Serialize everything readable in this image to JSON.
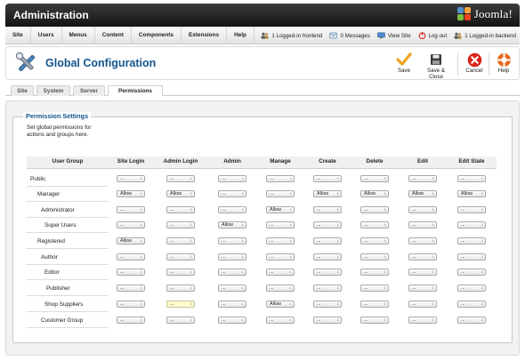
{
  "header": {
    "title": "Administration",
    "logo_text": "Joomla!"
  },
  "menu": [
    "Site",
    "Users",
    "Menus",
    "Content",
    "Components",
    "Extensions",
    "Help"
  ],
  "status": {
    "frontend": "1 Logged-in frontend",
    "messages": "0 Messages",
    "view_site": "View Site",
    "logout": "Log out",
    "backend": "1 Logged-in backend"
  },
  "toolbar": {
    "page_title": "Global Configuration",
    "buttons": [
      "Save",
      "Save & Close",
      "Cancel",
      "Help"
    ]
  },
  "tabs": [
    "Site",
    "System",
    "Server",
    "Permissions"
  ],
  "active_tab": "Permissions",
  "permissions": {
    "legend": "Permission Settings",
    "description": "Set global permissions for actions and groups here.",
    "group_header": "User Group",
    "actions": [
      "Site Login",
      "Admin Login",
      "Admin",
      "Manage",
      "Create",
      "Delete",
      "Edit",
      "Edit State"
    ],
    "rows": [
      {
        "group": "Public",
        "values": [
          "...",
          "...",
          "...",
          "...",
          "...",
          "...",
          "...",
          "..."
        ]
      },
      {
        "group": "Manager",
        "values": [
          "Allow",
          "Allow",
          "...",
          "...",
          "Allow",
          "Allow",
          "Allow",
          "Allow"
        ]
      },
      {
        "group": "Administrator",
        "values": [
          "...",
          "...",
          "...",
          "Allow",
          "...",
          "...",
          "...",
          "..."
        ]
      },
      {
        "group": "Super Users",
        "values": [
          "...",
          "...",
          "Allow",
          "...",
          "...",
          "...",
          "...",
          "..."
        ]
      },
      {
        "group": "Registered",
        "values": [
          "Allow",
          "...",
          "...",
          "...",
          "...",
          "...",
          "...",
          "..."
        ]
      },
      {
        "group": "Author",
        "values": [
          "...",
          "...",
          "...",
          "...",
          "...",
          "...",
          "...",
          "..."
        ]
      },
      {
        "group": "Editor",
        "values": [
          "...",
          "...",
          "...",
          "...",
          "...",
          "...",
          "...",
          "..."
        ]
      },
      {
        "group": "Publisher",
        "values": [
          "...",
          "...",
          "...",
          "...",
          "...",
          "...",
          "...",
          "..."
        ]
      },
      {
        "group": "Shop Suppliers",
        "values": [
          "...",
          "...",
          "...",
          "Allow",
          "...",
          "...",
          "...",
          "..."
        ]
      },
      {
        "group": "Customer Group",
        "values": [
          "...",
          "...",
          "...",
          "...",
          "...",
          "...",
          "...",
          "..."
        ]
      }
    ]
  },
  "colors": {
    "accent": "#13548c",
    "header_dark": "#1c1c1c",
    "save": "#f0a21c",
    "cancel": "#d9251c",
    "help": "#e86a1c"
  }
}
